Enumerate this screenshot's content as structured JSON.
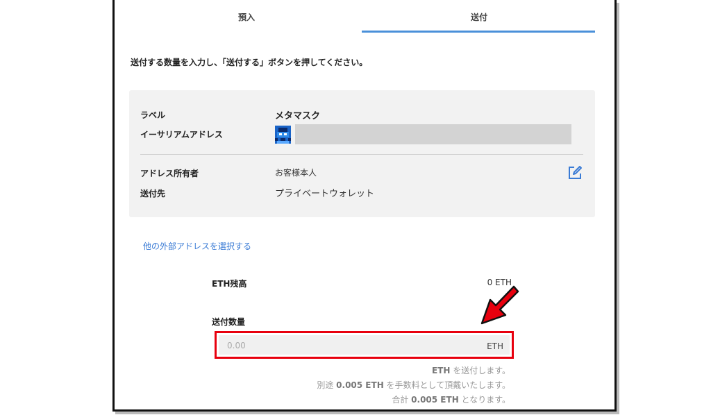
{
  "tabs": {
    "deposit": "預入",
    "send": "送付",
    "active": "send"
  },
  "instruction": "送付する数量を入力し、「送付する」ボタンを押してください。",
  "card": {
    "label_key": "ラベル",
    "label_value": "メタマスク",
    "address_key": "イーサリアムアドレス",
    "owner_key": "アドレス所有者",
    "owner_value": "お客様本人",
    "destination_key": "送付先",
    "destination_value": "プライベートウォレット",
    "edit_icon": "edit-icon"
  },
  "other_address_link": "他の外部アドレスを選択する",
  "balance": {
    "label": "ETH残高",
    "value": "0 ETH"
  },
  "amount": {
    "label": "送付数量",
    "placeholder": "0.00",
    "unit": "ETH"
  },
  "notes": {
    "line1_bold": "ETH",
    "line1_rest": " を送付します。",
    "line2_pre": "別途 ",
    "line2_bold": "0.005 ETH",
    "line2_rest": " を手数料として頂戴いたします。",
    "line3_pre": "合計 ",
    "line3_bold": "0.005 ETH",
    "line3_rest": " となります。"
  },
  "colors": {
    "accent": "#4a90d9",
    "highlight": "#e8000e",
    "card_bg": "#f2f2f2"
  }
}
